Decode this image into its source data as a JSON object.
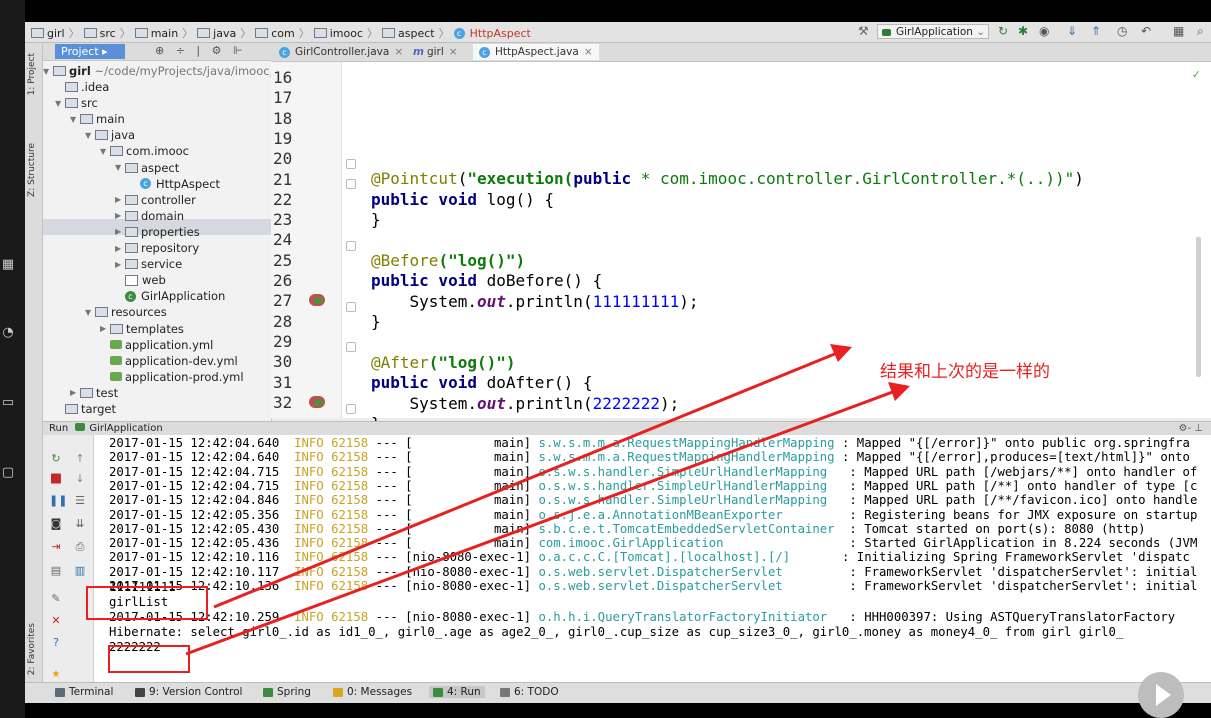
{
  "breadcrumb": [
    "girl",
    "src",
    "main",
    "java",
    "com",
    "imooc",
    "aspect",
    "HttpAspect"
  ],
  "toolbar": {
    "run_config": "GirlApplication"
  },
  "side_stripe": {
    "project": "1: Project",
    "structure": "Z: Structure",
    "favorites": "2: Favorites"
  },
  "project_panel": {
    "tab": "Project",
    "root_name": "girl",
    "root_path": "~/code/myProjects/java/imooc,",
    "items": [
      {
        "label": ".idea",
        "depth": 0,
        "arrow": ""
      },
      {
        "label": "src",
        "depth": 0,
        "arrow": "▼"
      },
      {
        "label": "main",
        "depth": 1,
        "arrow": "▼"
      },
      {
        "label": "java",
        "depth": 2,
        "arrow": "▼"
      },
      {
        "label": "com.imooc",
        "depth": 3,
        "arrow": "▼"
      },
      {
        "label": "aspect",
        "depth": 4,
        "arrow": "▼"
      },
      {
        "label": "HttpAspect",
        "depth": 5,
        "arrow": ""
      },
      {
        "label": "controller",
        "depth": 4,
        "arrow": "▶"
      },
      {
        "label": "domain",
        "depth": 4,
        "arrow": "▶"
      },
      {
        "label": "properties",
        "depth": 4,
        "arrow": "▶"
      },
      {
        "label": "repository",
        "depth": 4,
        "arrow": "▶"
      },
      {
        "label": "service",
        "depth": 4,
        "arrow": "▶"
      },
      {
        "label": "web",
        "depth": 4,
        "arrow": ""
      },
      {
        "label": "GirlApplication",
        "depth": 4,
        "arrow": ""
      },
      {
        "label": "resources",
        "depth": 2,
        "arrow": "▼"
      },
      {
        "label": "templates",
        "depth": 3,
        "arrow": "▶"
      },
      {
        "label": "application.yml",
        "depth": 3,
        "arrow": ""
      },
      {
        "label": "application-dev.yml",
        "depth": 3,
        "arrow": ""
      },
      {
        "label": "application-prod.yml",
        "depth": 3,
        "arrow": ""
      },
      {
        "label": "test",
        "depth": 1,
        "arrow": "▶"
      },
      {
        "label": "target",
        "depth": 0,
        "arrow": ""
      }
    ]
  },
  "editor": {
    "tabs": [
      "GirlController.java",
      "girl",
      "HttpAspect.java"
    ],
    "line_numbers": [
      "16",
      "17",
      "18",
      "19",
      "20",
      "21",
      "22",
      "23",
      "24",
      "25",
      "26",
      "27",
      "28",
      "29",
      "30",
      "31",
      "32"
    ],
    "code": {
      "l19_ann": "@Pointcut",
      "l19_open": "(",
      "l19_str1": "\"execution(",
      "l19_kw": "public",
      "l19_str2": " * com.imooc.controller.GirlController.*(..))\"",
      "l19_close": ")",
      "kw_public_void": "public void",
      "l20_rest": " log() {",
      "close_brace": "}",
      "l23_ann": "@Before",
      "l23_str": "(\"log()\")",
      "l24_rest": " doBefore() {",
      "sys": "System.",
      "out": "out",
      "println": ".println(",
      "n1": "111111111",
      "end": ");",
      "l28_ann": "@After",
      "l28_str": "(\"log()\")",
      "l29_rest": " doAfter() {",
      "n2": "2222222"
    }
  },
  "run_panel": {
    "title": "Run",
    "config": "GirlApplication",
    "log_lines": [
      {
        "ts": "2017-01-15 12:42:04.640",
        "level": "INFO",
        "pid": "62158",
        "thread": "--- [           main]",
        "cls": "s.w.s.m.m.a.RequestMappingHandlerMapping",
        "msg": ": Mapped \"{[/error]}\" onto public org.springfra"
      },
      {
        "ts": "2017-01-15 12:42:04.640",
        "level": "INFO",
        "pid": "62158",
        "thread": "--- [           main]",
        "cls": "s.w.s.m.m.a.RequestMappingHandlerMapping",
        "msg": ": Mapped \"{[/error],produces=[text/html]}\" onto"
      },
      {
        "ts": "2017-01-15 12:42:04.715",
        "level": "INFO",
        "pid": "62158",
        "thread": "--- [           main]",
        "cls": "o.s.w.s.handler.SimpleUrlHandlerMapping  ",
        "msg": ": Mapped URL path [/webjars/**] onto handler of"
      },
      {
        "ts": "2017-01-15 12:42:04.715",
        "level": "INFO",
        "pid": "62158",
        "thread": "--- [           main]",
        "cls": "o.s.w.s.handler.SimpleUrlHandlerMapping  ",
        "msg": ": Mapped URL path [/**] onto handler of type [c"
      },
      {
        "ts": "2017-01-15 12:42:04.846",
        "level": "INFO",
        "pid": "62158",
        "thread": "--- [           main]",
        "cls": "o.s.w.s.handler.SimpleUrlHandlerMapping  ",
        "msg": ": Mapped URL path [/**/favicon.ico] onto handle"
      },
      {
        "ts": "2017-01-15 12:42:05.356",
        "level": "INFO",
        "pid": "62158",
        "thread": "--- [           main]",
        "cls": "o.s.j.e.a.AnnotationMBeanExporter        ",
        "msg": ": Registering beans for JMX exposure on startup"
      },
      {
        "ts": "2017-01-15 12:42:05.430",
        "level": "INFO",
        "pid": "62158",
        "thread": "--- [           main]",
        "cls": "s.b.c.e.t.TomcatEmbeddedServletContainer ",
        "msg": ": Tomcat started on port(s): 8080 (http)"
      },
      {
        "ts": "2017-01-15 12:42:05.436",
        "level": "INFO",
        "pid": "62158",
        "thread": "--- [           main]",
        "cls": "com.imooc.GirlApplication                ",
        "msg": ": Started GirlApplication in 8.224 seconds (JVM"
      },
      {
        "ts": "2017-01-15 12:42:10.116",
        "level": "INFO",
        "pid": "62158",
        "thread": "--- [nio-8080-exec-1]",
        "cls": "o.a.c.c.C.[Tomcat].[localhost].[/]      ",
        "msg": ": Initializing Spring FrameworkServlet 'dispatc"
      },
      {
        "ts": "2017-01-15 12:42:10.117",
        "level": "INFO",
        "pid": "62158",
        "thread": "--- [nio-8080-exec-1]",
        "cls": "o.s.web.servlet.DispatcherServlet        ",
        "msg": ": FrameworkServlet 'dispatcherServlet': initial"
      },
      {
        "ts": "2017-01-15 12:42:10.136",
        "level": "INFO",
        "pid": "62158",
        "thread": "--- [nio-8080-exec-1]",
        "cls": "o.s.web.servlet.DispatcherServlet        ",
        "msg": ": FrameworkServlet 'dispatcherServlet': initial"
      }
    ],
    "output1": "111111111",
    "output2": "girlList",
    "log_after": {
      "ts": "2017-01-15 12:42:10.259",
      "level": "INFO",
      "pid": "62158",
      "thread": "--- [nio-8080-exec-1]",
      "cls": "o.h.h.i.QueryTranslatorFactoryInitiator  ",
      "msg": ": HHH000397: Using ASTQueryTranslatorFactory"
    },
    "hibernate": "Hibernate: select girl0_.id as id1_0_, girl0_.age as age2_0_, girl0_.cup_size as cup_size3_0_, girl0_.money as money4_0_ from girl girl0_",
    "output3": "2222222"
  },
  "bottom_tools": [
    "Terminal",
    "9: Version Control",
    "Spring",
    "0: Messages",
    "4: Run",
    "6: TODO"
  ],
  "annotation": {
    "text": "结果和上次的是一样的",
    "color": "#e82020"
  }
}
